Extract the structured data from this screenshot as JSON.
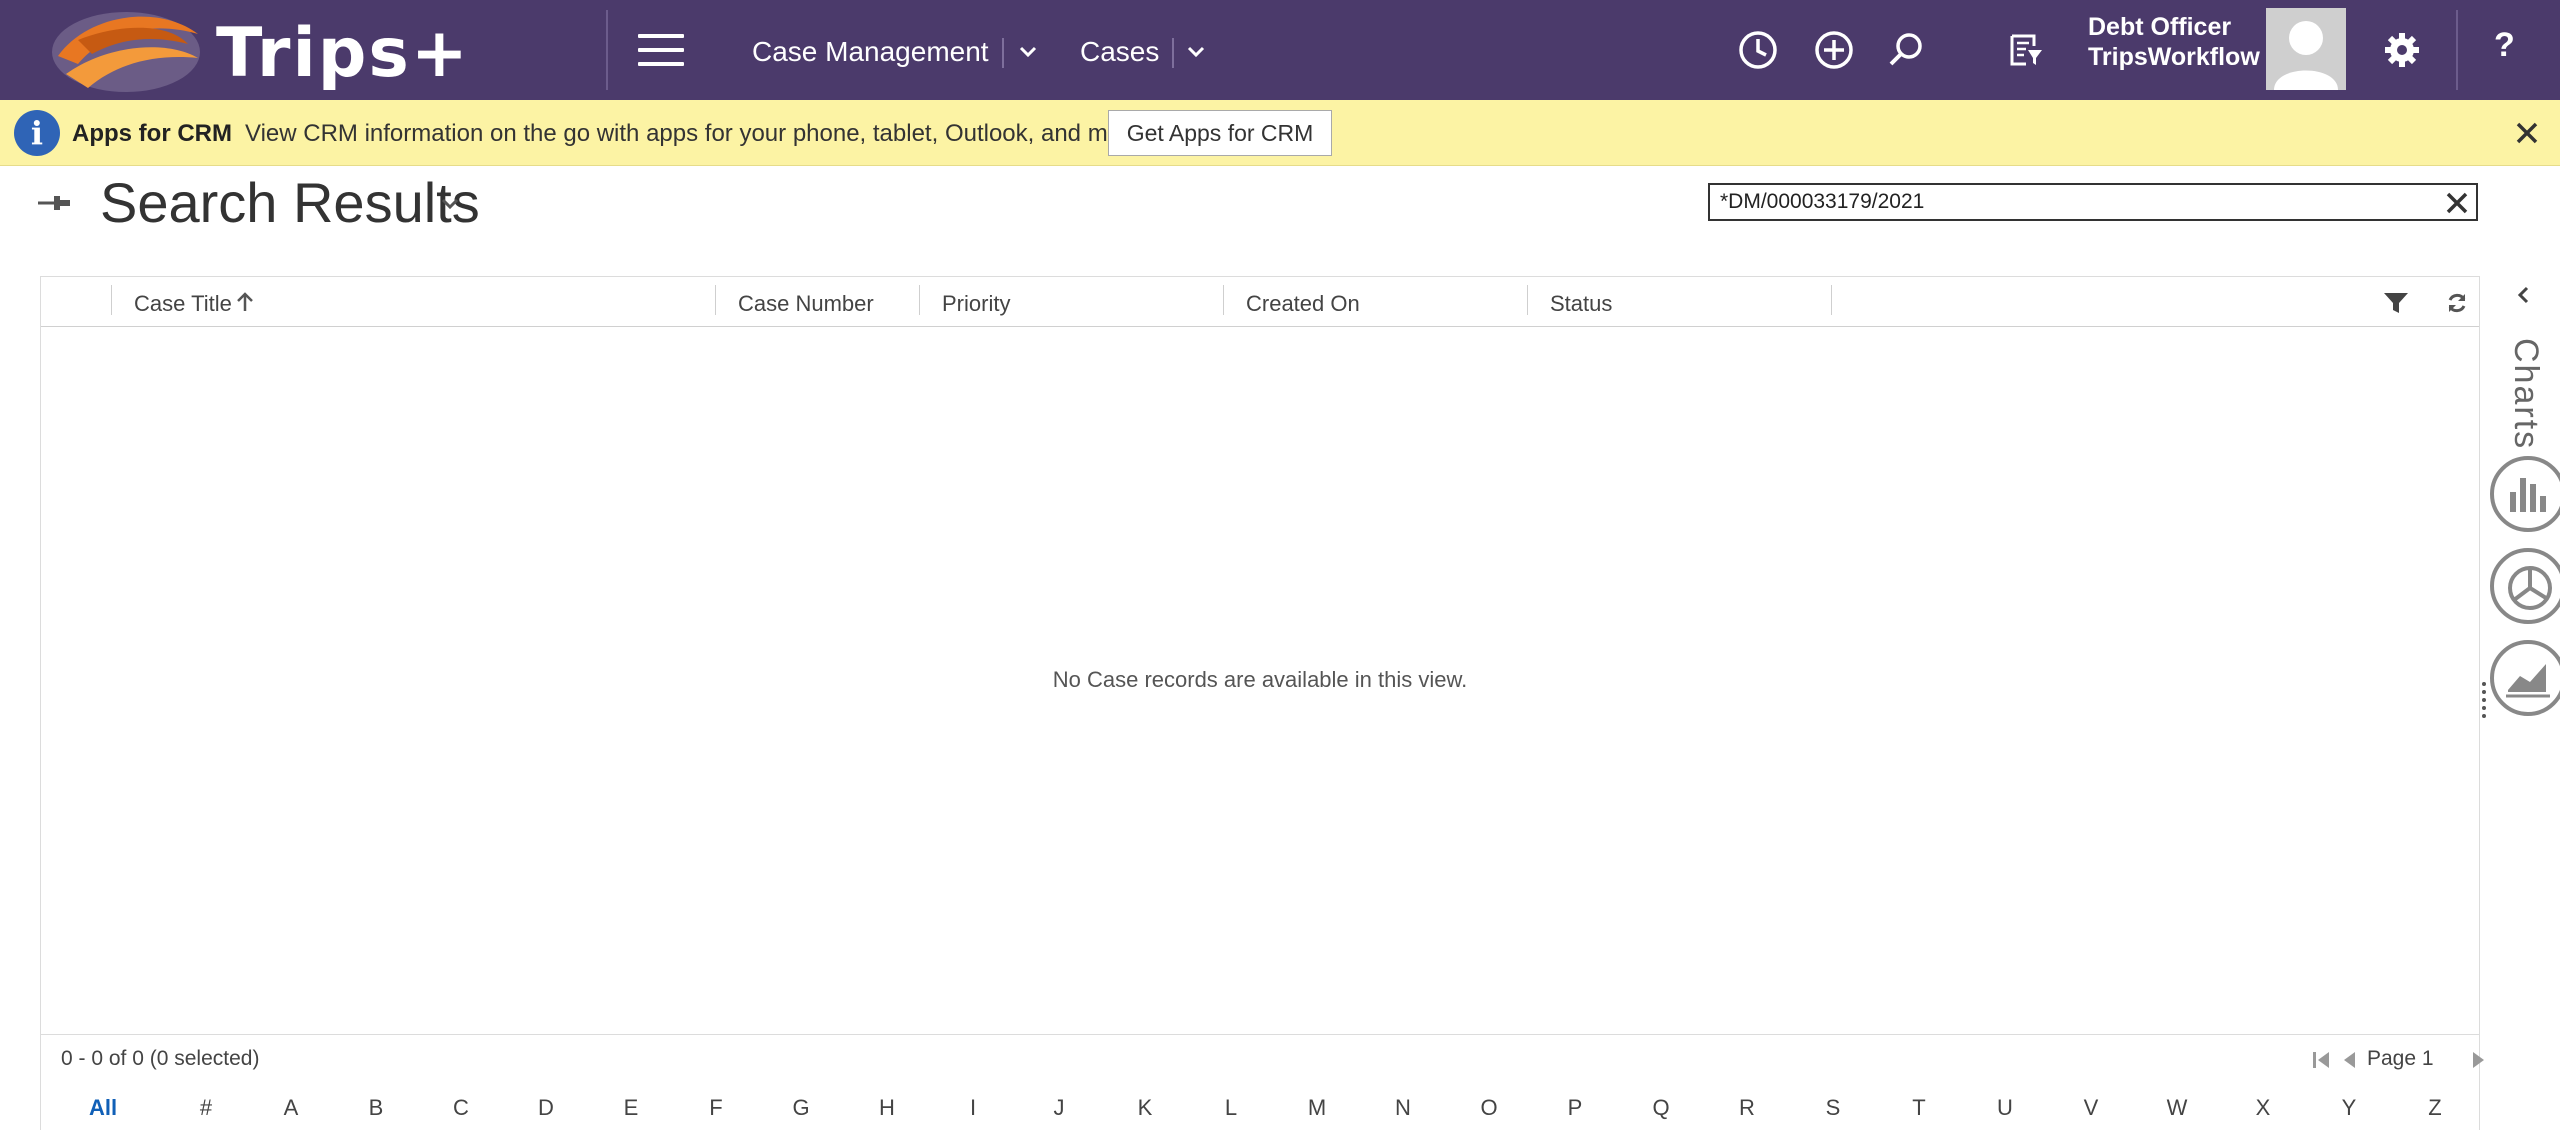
{
  "header": {
    "brand": "Trips+",
    "nav_area": "Case Management",
    "nav_entity": "Cases",
    "user_name": "Debt Officer",
    "user_org": "TripsWorkflow",
    "help_label": "?"
  },
  "notification": {
    "title": "Apps for CRM",
    "message": "View CRM information on the go with apps for your phone, tablet, Outlook, and more!",
    "button_label": "Get Apps for CRM"
  },
  "page": {
    "title": "Search Results",
    "search_value": "*DM/000033179/2021"
  },
  "grid": {
    "columns": [
      "Case Title",
      "Case Number",
      "Priority",
      "Created On",
      "Status"
    ],
    "sorted_column": "Case Title",
    "sort_direction": "ascending",
    "empty_message": "No Case records are available in this view.",
    "record_count": "0 - 0 of 0 (0 selected)",
    "page_label": "Page 1",
    "alphabet": [
      "All",
      "#",
      "A",
      "B",
      "C",
      "D",
      "E",
      "F",
      "G",
      "H",
      "I",
      "J",
      "K",
      "L",
      "M",
      "N",
      "O",
      "P",
      "Q",
      "R",
      "S",
      "T",
      "U",
      "V",
      "W",
      "X",
      "Y",
      "Z"
    ],
    "active_letter": "All"
  },
  "charts_pane": {
    "label": "Charts"
  },
  "colors": {
    "topbar": "#4b3a6b",
    "notification": "#fcf3a4",
    "info_icon": "#2f64b6",
    "active_link": "#1160b7"
  },
  "icons": [
    "menu-icon",
    "recent-icon",
    "create-icon",
    "search-icon",
    "advanced-find-icon",
    "gear-icon",
    "info-icon",
    "close-icon",
    "pin-icon",
    "chevron-down-icon",
    "sort-up-icon",
    "filter-icon",
    "refresh-icon",
    "first-page-icon",
    "prev-page-icon",
    "next-page-icon",
    "chevron-left-icon",
    "bar-chart-icon",
    "pie-chart-icon",
    "line-chart-icon"
  ]
}
